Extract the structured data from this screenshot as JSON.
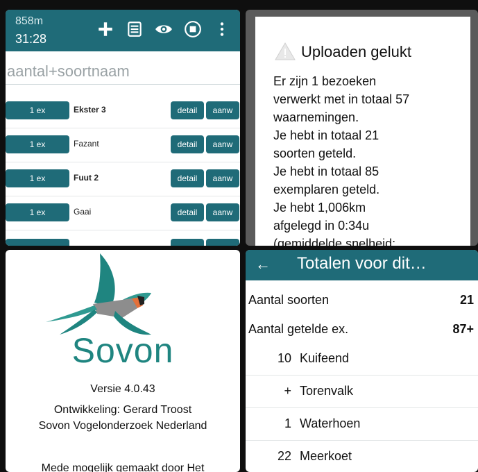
{
  "top_left": {
    "distance": "858m",
    "time": "31:28",
    "icons": [
      "plus-icon",
      "document-icon",
      "eye-icon",
      "stop-icon",
      "more-vert-icon"
    ],
    "search_placeholder": "aantal+soortnaam",
    "rows": [
      {
        "count": "1 ex",
        "name": "Ekster 3",
        "bold": true,
        "detail": "detail",
        "aanw": "aanw"
      },
      {
        "count": "1 ex",
        "name": "Fazant",
        "bold": false,
        "detail": "detail",
        "aanw": "aanw"
      },
      {
        "count": "1 ex",
        "name": "Fuut 2",
        "bold": true,
        "detail": "detail",
        "aanw": "aanw"
      },
      {
        "count": "1 ex",
        "name": "Gaai",
        "bold": false,
        "detail": "detail",
        "aanw": "aanw"
      }
    ]
  },
  "top_right": {
    "title": "Uploaden gelukt",
    "body_lines": [
      "Er zijn 1 bezoeken",
      "verwerkt met in totaal 57",
      "waarnemingen.",
      "Je hebt in totaal 21",
      "soorten geteld.",
      "Je hebt in totaal 85",
      "exemplaren geteld.",
      "Je hebt 1,006km",
      "afgelegd in 0:34u",
      "(gemiddelde snelheid:"
    ]
  },
  "bottom_left": {
    "brand": "Sovon",
    "version": "Versie 4.0.43",
    "developer": "Ontwikkeling: Gerard Troost",
    "organisation": "Sovon Vogelonderzoek Nederland",
    "credits": "Mede mogelijk gemaakt door Het"
  },
  "bottom_right": {
    "back_icon": "arrow-left-icon",
    "title": "Totalen voor dit…",
    "stats": [
      {
        "label": "Aantal soorten",
        "value": "21"
      },
      {
        "label": "Aantal getelde ex.",
        "value": "87+"
      }
    ],
    "totals": [
      {
        "num": "10",
        "name": "Kuifeend"
      },
      {
        "num": "+",
        "name": "Torenvalk"
      },
      {
        "num": "1",
        "name": "Waterhoen"
      },
      {
        "num": "22",
        "name": "Meerkoet"
      }
    ]
  },
  "colors": {
    "primary": "#1f6b78",
    "brand_green": "#1f8580"
  }
}
